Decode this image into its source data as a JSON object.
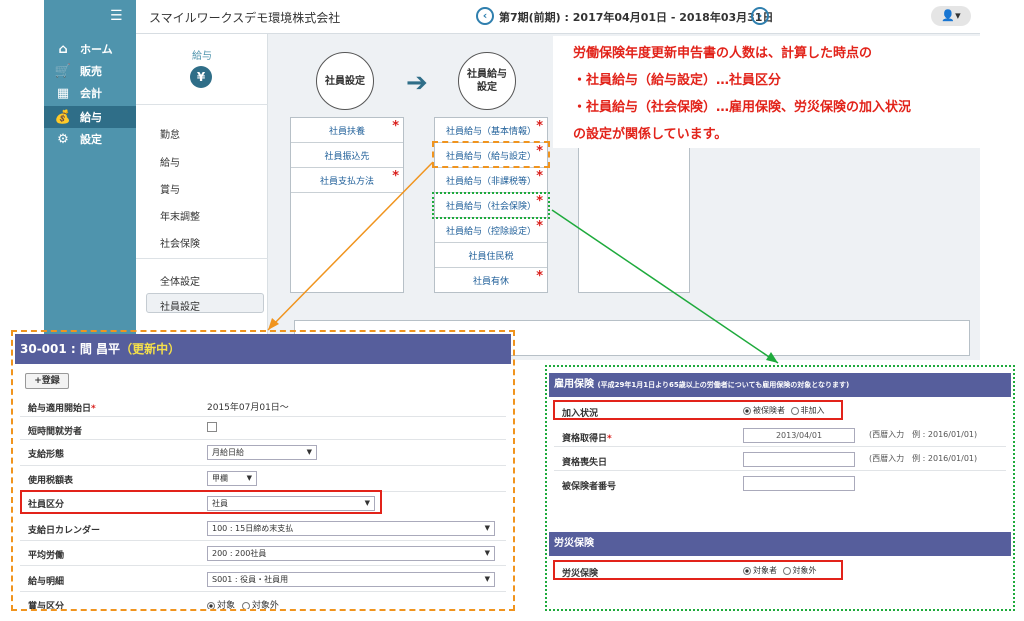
{
  "header": {
    "company": "スマイルワークスデモ環境株式会社",
    "period": "第7期(前期) : 2017年04月01日 - 2018年03月31日"
  },
  "sidebar": {
    "items": [
      {
        "label": "ホーム",
        "icon": "home-icon"
      },
      {
        "label": "販売",
        "icon": "cart-icon"
      },
      {
        "label": "会計",
        "icon": "calculator-icon"
      },
      {
        "label": "給与",
        "icon": "money-bag-icon"
      },
      {
        "label": "設定",
        "icon": "gear-icon"
      }
    ]
  },
  "submenu": {
    "title": "給与",
    "items": [
      "勤怠",
      "給与",
      "賞与",
      "年末調整",
      "社会保険",
      "全体設定",
      "社員設定"
    ]
  },
  "flow": {
    "step1": "社員設定",
    "step2": "社員給与\n設定",
    "col1": [
      "社員扶養",
      "社員振込先",
      "社員支払方法"
    ],
    "col2": [
      "社員給与（基本情報）",
      "社員給与（給与設定）",
      "社員給与（非課税等）",
      "社員給与（社会保険）",
      "社員給与（控除設定）",
      "社員住民税",
      "社員有休"
    ]
  },
  "note": {
    "lines": [
      "労働保険年度更新申告書の人数は、計算した時点の",
      "・社員給与（給与設定）…社員区分",
      "・社員給与（社会保険）…雇用保険、労災保険の加入状況",
      "の設定が関係しています。"
    ]
  },
  "left_panel": {
    "title": "30-001 : 間 昌平",
    "status": "（更新中）",
    "register_button": "+登録",
    "rows": [
      {
        "label": "給与適用開始日",
        "value": "2015年07月01日～"
      },
      {
        "label": "短時間就労者",
        "value": ""
      },
      {
        "label": "支給形態",
        "value": "月給日給"
      },
      {
        "label": "使用税額表",
        "value": "甲欄"
      },
      {
        "label": "社員区分",
        "value": "社員"
      },
      {
        "label": "支給日カレンダー",
        "value": "100 : 15日締め末支払"
      },
      {
        "label": "平均労働",
        "value": "200 : 200社員"
      },
      {
        "label": "給与明細",
        "value": "S001 : 役員・社員用"
      },
      {
        "label": "賞与区分",
        "value": "対象"
      }
    ],
    "bonus_option2": "対象外"
  },
  "right_panel": {
    "employment_title": "雇用保険",
    "employment_note": "(平成29年1月1日より65歳以上の労働者についても雇用保険の対象となります)",
    "rows": [
      {
        "label": "加入状況",
        "option1": "被保険者",
        "option2": "非加入"
      },
      {
        "label": "資格取得日",
        "value": "2013/04/01",
        "hint": "(西暦入力　例 : 2016/01/01)"
      },
      {
        "label": "資格喪失日",
        "value": "",
        "hint": "(西暦入力　例 : 2016/01/01)"
      },
      {
        "label": "被保険者番号",
        "value": ""
      }
    ],
    "workers_title": "労災保険",
    "workers_label": "労災保険",
    "workers_option1": "対象者",
    "workers_option2": "対象外"
  }
}
